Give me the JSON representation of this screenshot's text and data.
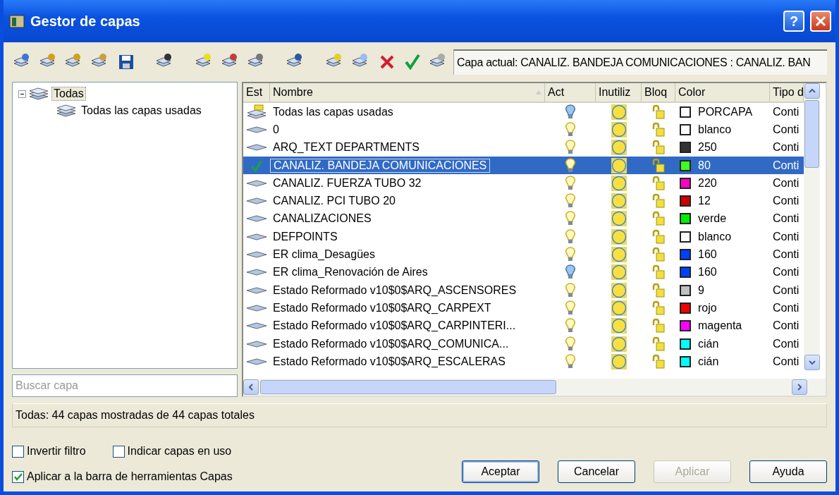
{
  "window": {
    "title": "Gestor de capas"
  },
  "toolbar": {
    "current_layer": "Capa actual: CANALIZ.  BANDEJA COMUNICACIONES : CANALIZ.  BAN"
  },
  "tree": {
    "items": [
      {
        "label": "Todas",
        "selected": true,
        "expanded": true,
        "children": [
          {
            "label": "Todas las capas usadas",
            "selected": false
          }
        ]
      }
    ]
  },
  "search": {
    "placeholder": "Buscar capa"
  },
  "table": {
    "columns": [
      "Est",
      "Nombre",
      "Act",
      "Inutiliz",
      "Bloq",
      "Color",
      "Tipo d"
    ],
    "rows": [
      {
        "kind": "filter",
        "name": "Todas las capas usadas",
        "on": false,
        "selected": false,
        "color": "#ffffff",
        "color_label": "PORCAPA",
        "linetype": "Conti"
      },
      {
        "kind": "layer",
        "current": false,
        "name": "0",
        "on": true,
        "selected": false,
        "color": "#ffffff",
        "color_label": "blanco",
        "linetype": "Conti"
      },
      {
        "kind": "layer",
        "current": false,
        "name": "ARQ_TEXT DEPARTMENTS",
        "on": true,
        "selected": false,
        "color": "#333333",
        "color_label": "250",
        "linetype": "Conti"
      },
      {
        "kind": "layer",
        "current": true,
        "name": "CANALIZ.  BANDEJA COMUNICACIONES",
        "on": true,
        "selected": true,
        "color": "#40ff20",
        "color_label": "80",
        "linetype": "Conti"
      },
      {
        "kind": "layer",
        "current": false,
        "name": "CANALIZ. FUERZA TUBO 32",
        "on": true,
        "selected": false,
        "color": "#ff00c0",
        "color_label": "220",
        "linetype": "Conti"
      },
      {
        "kind": "layer",
        "current": false,
        "name": "CANALIZ. PCI TUBO 20",
        "on": true,
        "selected": false,
        "color": "#cc0000",
        "color_label": "12",
        "linetype": "Conti"
      },
      {
        "kind": "layer",
        "current": false,
        "name": "CANALIZACIONES",
        "on": true,
        "selected": false,
        "color": "#00ee00",
        "color_label": "verde",
        "linetype": "Conti"
      },
      {
        "kind": "layer",
        "current": false,
        "name": "DEFPOINTS",
        "on": true,
        "selected": false,
        "color": "#ffffff",
        "color_label": "blanco",
        "linetype": "Conti"
      },
      {
        "kind": "layer",
        "current": false,
        "name": "ER clima_Desagües",
        "on": true,
        "selected": false,
        "color": "#0040ff",
        "color_label": "160",
        "linetype": "Conti"
      },
      {
        "kind": "layer",
        "current": false,
        "name": "ER clima_Renovación de Aires",
        "on": false,
        "selected": false,
        "color": "#0040ff",
        "color_label": "160",
        "linetype": "Conti"
      },
      {
        "kind": "layer",
        "current": false,
        "name": "Estado Reformado v10$0$ARQ_ASCENSORES",
        "on": true,
        "selected": false,
        "color": "#c0c0c0",
        "color_label": "9",
        "linetype": "Conti"
      },
      {
        "kind": "layer",
        "current": false,
        "name": "Estado Reformado v10$0$ARQ_CARPEXT",
        "on": true,
        "selected": false,
        "color": "#ee0000",
        "color_label": "rojo",
        "linetype": "Conti"
      },
      {
        "kind": "layer",
        "current": false,
        "name": "Estado Reformado v10$0$ARQ_CARPINTERI...",
        "on": true,
        "selected": false,
        "color": "#ff00ff",
        "color_label": "magenta",
        "linetype": "Conti"
      },
      {
        "kind": "layer",
        "current": false,
        "name": "Estado Reformado v10$0$ARQ_COMUNICA...",
        "on": true,
        "selected": false,
        "color": "#00ffff",
        "color_label": "cián",
        "linetype": "Conti"
      },
      {
        "kind": "layer",
        "current": false,
        "name": "Estado Reformado v10$0$ARQ_ESCALERAS",
        "on": true,
        "selected": false,
        "color": "#00ffff",
        "color_label": "cián",
        "linetype": "Conti"
      }
    ]
  },
  "status_bar": "Todas: 44 capas mostradas de 44 capas totales",
  "options": [
    {
      "label": "Invertir filtro",
      "checked": false
    },
    {
      "label": "Indicar capas en uso",
      "checked": false
    },
    {
      "label": "Aplicar a la barra de herramientas Capas",
      "checked": true
    }
  ],
  "buttons": [
    {
      "label": "Aceptar",
      "disabled": false,
      "default": true
    },
    {
      "label": "Cancelar",
      "disabled": false,
      "default": false
    },
    {
      "label": "Aplicar",
      "disabled": true,
      "default": false
    },
    {
      "label": "Ayuda",
      "disabled": false,
      "default": false
    }
  ],
  "title_buttons": [
    "?"
  ]
}
